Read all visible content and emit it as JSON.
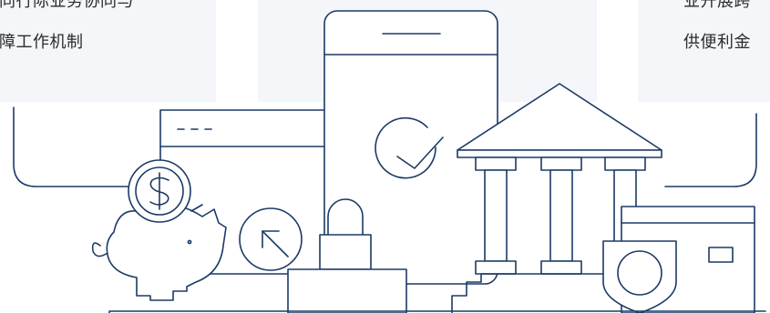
{
  "cards": {
    "left": {
      "line1": "同行际业务协同与",
      "line2": "障工作机制"
    },
    "right": {
      "line1": "业开展跨",
      "line2": "供便利金"
    }
  },
  "illustration": {
    "stroke_color": "#1b3a66",
    "card_bg": "#f4f6fa",
    "icons": [
      "piggy-bank",
      "dollar-coin",
      "smartphone",
      "check-circle",
      "bank-building",
      "shield",
      "credit-card",
      "arrow-circle",
      "padlock",
      "browser-window"
    ]
  }
}
